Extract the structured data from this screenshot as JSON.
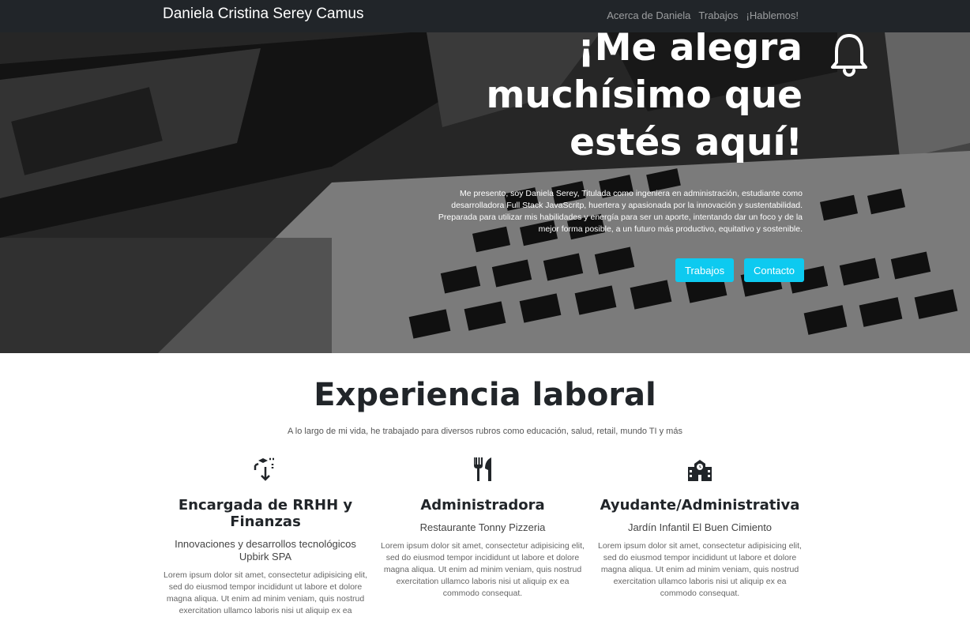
{
  "navbar": {
    "brand": "Daniela Cristina Serey Camus",
    "links": [
      {
        "label": "Acerca de Daniela"
      },
      {
        "label": "Trabajos"
      },
      {
        "label": "¡Hablemos!"
      }
    ]
  },
  "hero": {
    "title": "¡Me alegra muchísimo que estés aquí!",
    "description": "Me presento, soy Daniela Serey, Titulada como ingeniera en administración, estudiante como desarrolladora Full Stack JavaScritp, huertera y apasionada por la innovación y sustentabilidad. Preparada para utilizar mis habilidades y energía para ser un aporte, intentando dar un foco y de la mejor forma posible, a un futuro más productivo, equitativo y sostenible.",
    "buttons": {
      "trabajos": "Trabajos",
      "contacto": "Contacto"
    },
    "icon": "bell-icon"
  },
  "experience": {
    "title": "Experiencia laboral",
    "subtitle": "A lo largo de mi vida, he trabajado para diversos rubros como educación, salud, retail, mundo TI y más",
    "jobs": [
      {
        "icon": "cube-icon",
        "title": "Encargada de RRHH y Finanzas",
        "company": "Innovaciones y desarrollos tecnológicos Upbirk SPA",
        "text": "Lorem ipsum dolor sit amet, consectetur adipisicing elit, sed do eiusmod tempor incididunt ut labore et dolore magna aliqua. Ut enim ad minim veniam, quis nostrud exercitation ullamco laboris nisi ut aliquip ex ea"
      },
      {
        "icon": "utensils-icon",
        "title": "Administradora",
        "company": "Restaurante Tonny Pizzeria",
        "text": "Lorem ipsum dolor sit amet, consectetur adipisicing elit, sed do eiusmod tempor incididunt ut labore et dolore magna aliqua. Ut enim ad minim veniam, quis nostrud exercitation ullamco laboris nisi ut aliquip ex ea commodo consequat."
      },
      {
        "icon": "school-icon",
        "title": "Ayudante/Administrativa",
        "company": "Jardín Infantil El Buen Cimiento",
        "text": "Lorem ipsum dolor sit amet, consectetur adipisicing elit, sed do eiusmod tempor incididunt ut labore et dolore magna aliqua. Ut enim ad minim veniam, quis nostrud exercitation ullamco laboris nisi ut aliquip ex ea commodo consequat."
      }
    ]
  },
  "colors": {
    "navbar": "#212529",
    "button": "#0dcaf0"
  }
}
